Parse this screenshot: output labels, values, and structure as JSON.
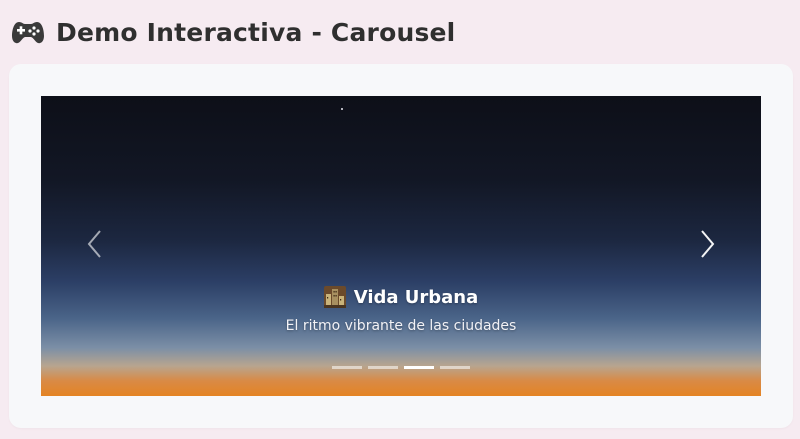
{
  "header": {
    "title": "Demo Interactiva - Carousel",
    "icon": "game-controller-icon"
  },
  "carousel": {
    "active_index": 2,
    "slide": {
      "title": "Vida Urbana",
      "subtitle": "El ritmo vibrante de las ciudades",
      "icon": "city-icon"
    },
    "controls": {
      "prev_icon": "chevron-left-icon",
      "next_icon": "chevron-right-icon"
    },
    "indicator_count": 4,
    "colors": {
      "sky_top": "#0d0f18",
      "horizon": "#e48423",
      "indicator_active": "#ffffff"
    }
  },
  "colors": {
    "page_background": "#f6ebf1",
    "card_background": "#f7f8fa"
  }
}
